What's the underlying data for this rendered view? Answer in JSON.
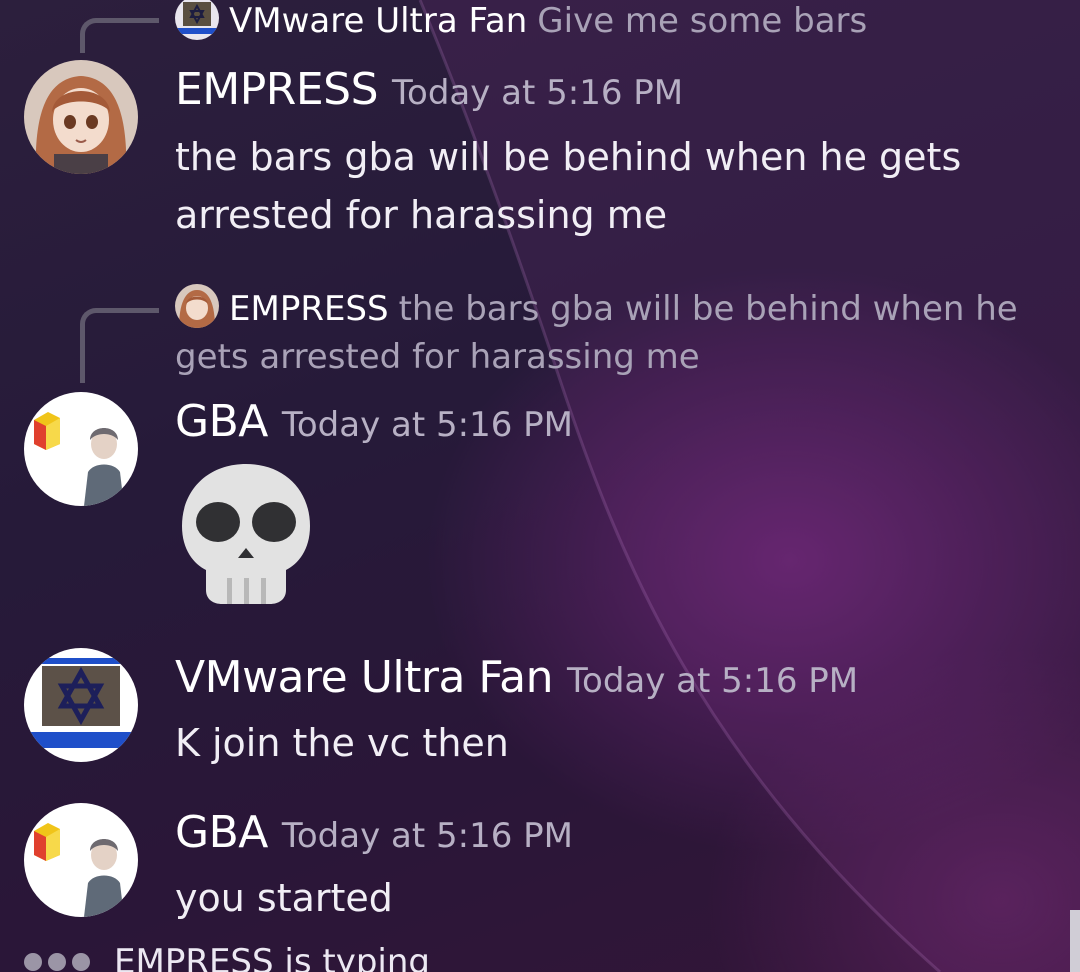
{
  "messages": [
    {
      "reply_to": {
        "username": "VMware Ultra Fan",
        "text": "Give me some bars"
      },
      "username": "EMPRESS",
      "timestamp": "Today at 5:16 PM",
      "text": "the bars gba will be behind when he gets arrested for harassing me"
    },
    {
      "reply_to": {
        "username": "EMPRESS",
        "text": "the bars gba will be behind when he gets arrested for harassing me"
      },
      "username": "GBA",
      "timestamp": "Today at 5:16 PM",
      "emoji": "skull-emoji"
    },
    {
      "username": "VMware Ultra Fan",
      "timestamp": "Today at 5:16 PM",
      "text": "K join the vc then"
    },
    {
      "username": "GBA",
      "timestamp": "Today at 5:16 PM",
      "text": "you started"
    }
  ],
  "typing_indicator": {
    "text": "EMPRESS is typing"
  },
  "colors": {
    "accent_purple": "#6c2676",
    "username": "#ffffff",
    "timestamp": "#b7b0c4",
    "reply_text": "#a9a2b7"
  }
}
